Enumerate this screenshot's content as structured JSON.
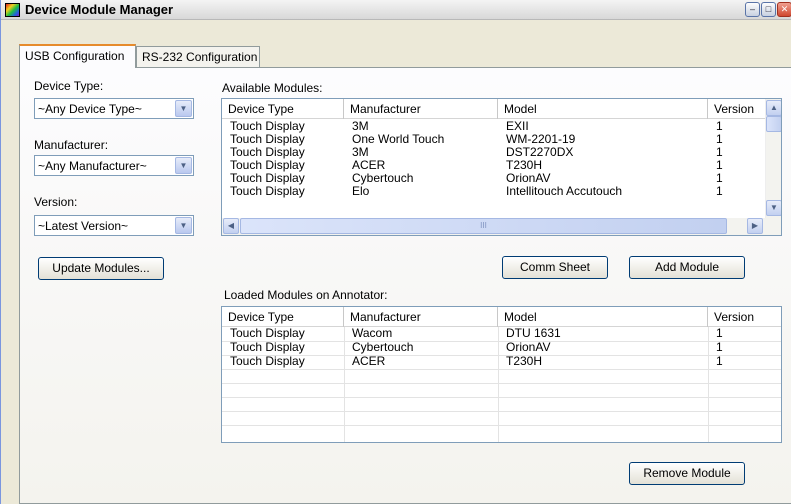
{
  "window": {
    "title": "Device Module Manager",
    "minimize": "–",
    "maximize": "□",
    "close": "✕"
  },
  "tabs": [
    {
      "label": "USB Configuration",
      "active": true
    },
    {
      "label": "RS-232 Configuration",
      "active": false
    }
  ],
  "filters": {
    "device_type_label": "Device Type:",
    "device_type_value": "~Any Device Type~",
    "manufacturer_label": "Manufacturer:",
    "manufacturer_value": "~Any Manufacturer~",
    "version_label": "Version:",
    "version_value": "~Latest Version~"
  },
  "buttons": {
    "update_modules": "Update Modules...",
    "comm_sheet": "Comm Sheet",
    "add_module": "Add Module",
    "remove_module": "Remove Module"
  },
  "available": {
    "label": "Available Modules:",
    "columns": [
      "Device Type",
      "Manufacturer",
      "Model",
      "Version"
    ],
    "rows": [
      [
        "Touch Display",
        "3M",
        "EXII",
        "1"
      ],
      [
        "Touch Display",
        "One World Touch",
        "WM-2201-19",
        "1"
      ],
      [
        "Touch Display",
        "3M",
        "DST2270DX",
        "1"
      ],
      [
        "Touch Display",
        "ACER",
        "T230H",
        "1"
      ],
      [
        "Touch Display",
        "Cybertouch",
        "OrionAV",
        "1"
      ],
      [
        "Touch Display",
        "Elo",
        "Intellitouch Accutouch",
        "1"
      ]
    ],
    "hscroll_grip": "III"
  },
  "loaded": {
    "label": "Loaded Modules on Annotator:",
    "columns": [
      "Device Type",
      "Manufacturer",
      "Model",
      "Version"
    ],
    "rows": [
      [
        "Touch Display",
        "Wacom",
        "DTU 1631",
        "1"
      ],
      [
        "Touch Display",
        "Cybertouch",
        "OrionAV",
        "1"
      ],
      [
        "Touch Display",
        "ACER",
        "T230H",
        "1"
      ]
    ]
  }
}
